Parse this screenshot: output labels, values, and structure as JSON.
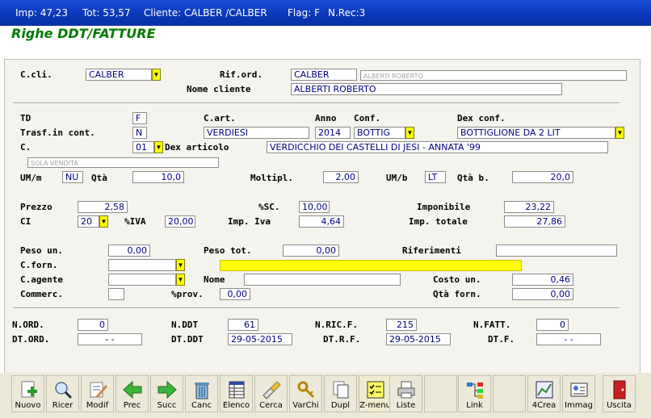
{
  "titlebar": {
    "imp": "Imp: 47,23",
    "tot": "Tot: 53,57",
    "cliente": "Cliente: CALBER /CALBER",
    "flag": "Flag: F",
    "nrec": "N.Rec:3"
  },
  "heading": "Righe DDT/FATTURE",
  "header": {
    "ccli_label": "C.cli.",
    "ccli_value": "CALBER",
    "riford_label": "Rif.ord.",
    "riford_value": "CALBER",
    "riford_hint": "ALBERTI ROBERTO",
    "nome_label": "Nome cliente",
    "nome_value": "ALBERTI ROBERTO"
  },
  "article": {
    "td_label": "TD",
    "td_value": "F",
    "cart_label": "C.art.",
    "cart_value": "VERDIESI",
    "anno_label": "Anno",
    "anno_value": "2014",
    "conf_label": "Conf.",
    "conf_value": "BOTTIG",
    "dexconf_label": "Dex conf.",
    "dexconf_value": "BOTTIGLIONE DA 2 LIT",
    "trasf_label": "Trasf.in cont.",
    "trasf_value": "N",
    "c_label": "C.",
    "c_value": "01",
    "dexart_label": "Dex articolo",
    "dexart_value": "VERDICCHIO DEI CASTELLI DI JESI - ANNATA '99",
    "vendita_hint": "SOLA VENDITA",
    "umm_label": "UM/m",
    "umm_value": "NU",
    "qta_label": "Qtà",
    "qta_value": "10,0",
    "moltipl_label": "Moltipl.",
    "moltipl_value": "2,00",
    "umb_label": "UM/b",
    "umb_value": "LT",
    "qtab_label": "Qtà b.",
    "qtab_value": "20,0"
  },
  "pricing": {
    "prezzo_label": "Prezzo",
    "prezzo_value": "2,58",
    "sc_label": "%SC.",
    "sc_value": "10,00",
    "imponibile_label": "Imponibile",
    "imponibile_value": "23,22",
    "ci_label": "CI",
    "ci_value": "20",
    "iva_label": "%IVA",
    "iva_value": "20,00",
    "impiva_label": "Imp. Iva",
    "impiva_value": "4,64",
    "imptot_label": "Imp. totale",
    "imptot_value": "27,86"
  },
  "extra": {
    "pesoun_label": "Peso un.",
    "pesoun_value": "0,00",
    "pesotot_label": "Peso tot.",
    "pesotot_value": "0,00",
    "rif_label": "Riferimenti",
    "rif_value": "",
    "cforn_label": "C.forn.",
    "cforn_value": "",
    "cagente_label": "C.agente",
    "cagente_value": "",
    "nome_label": "Nome",
    "nome_value": "",
    "costoun_label": "Costo un.",
    "costoun_value": "0,46",
    "commerc_label": "Commerc.",
    "commerc_value": "",
    "prov_label": "%prov.",
    "prov_value": "0,00",
    "qtaforn_label": "Qtà forn.",
    "qtaforn_value": "0,00"
  },
  "docs": {
    "nord_label": "N.ORD.",
    "nord_value": "0",
    "nddt_label": "N.DDT",
    "nddt_value": "61",
    "nricf_label": "N.RIC.F.",
    "nricf_value": "215",
    "nfatt_label": "N.FATT.",
    "nfatt_value": "0",
    "dtord_label": "DT.ORD.",
    "dtord_value": "-   -",
    "dtddt_label": "DT.DDT",
    "dtddt_value": "29-05-2015",
    "dtrf_label": "DT.R.F.",
    "dtrf_value": "29-05-2015",
    "dtf_label": "DT.F.",
    "dtf_value": "-   -"
  },
  "toolbar": [
    "Nuovo",
    "Ricer",
    "Modif",
    "Prec",
    "Succ",
    "Canc",
    "Elenco",
    "Cerca",
    "VarChi",
    "Dupl",
    "Z-menu",
    "Liste",
    "Link",
    "4Crea",
    "Immag",
    "Uscita"
  ],
  "dropdown_glyph": "▼"
}
